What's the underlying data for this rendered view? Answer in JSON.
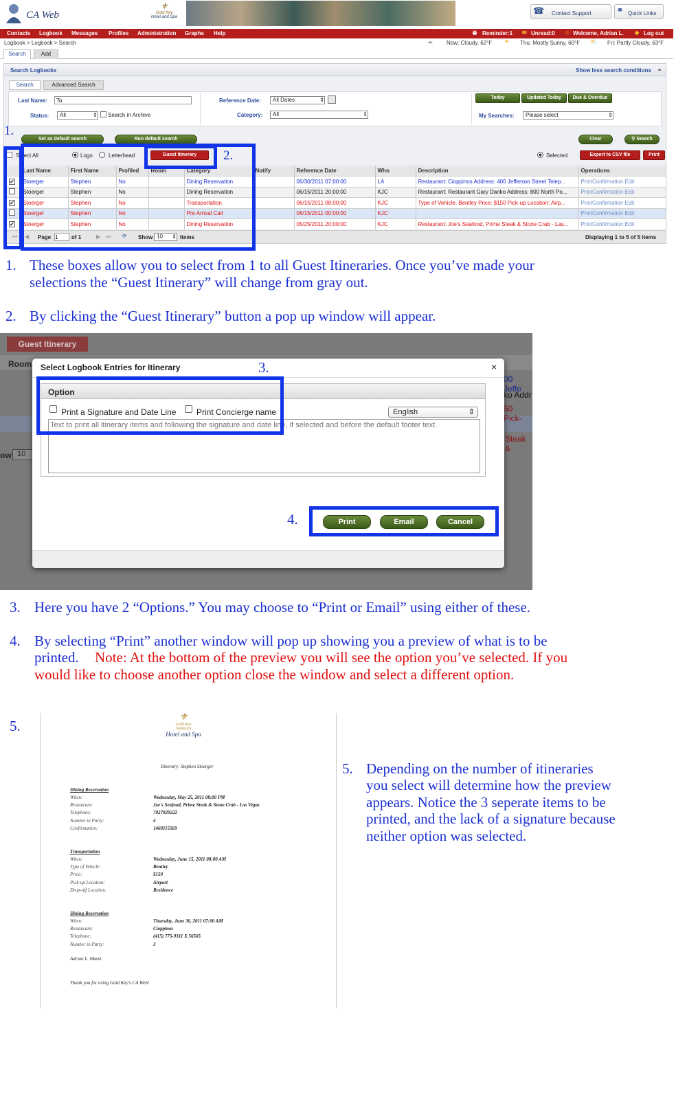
{
  "app": {
    "name": "CA Web",
    "hotel_line1": "Gold Key",
    "hotel_line2": "Solutions",
    "hotel_line3": "Hotel and Spa",
    "contact_support": "Contact Support",
    "quick_links": "Quick Links"
  },
  "nav": [
    "Contacts",
    "Logbook",
    "Messages",
    "Profiles",
    "Administration",
    "Graphs",
    "Help"
  ],
  "status": {
    "reminder": "Reminder:1",
    "unread": "Unread:0",
    "welcome": "Welcome, Adrian L.",
    "logout": "Log out"
  },
  "breadcrumb": "Logbook > Logbook > Search",
  "weather": {
    "now": "Now: Cloudy, 62°F",
    "thu": "Thu: Mostly Sunny, 60°F",
    "fri": "Fri: Partly Cloudy, 63°F"
  },
  "tabs": [
    "Search",
    "Add"
  ],
  "panel": {
    "title": "Search Logbooks",
    "toggle": "Show less search conditions",
    "subtabs": [
      "Search",
      "Advanced Search"
    ]
  },
  "form": {
    "last_name_label": "Last Name:",
    "last_name_value": "To",
    "status_label": "Status:",
    "status_value": "All",
    "archive_label": "Search in Archive",
    "ref_date_label": "Reference Date:",
    "ref_date_value": "All Dates",
    "category_label": "Category:",
    "category_value": "All",
    "today": "Today",
    "updated_today": "Updated Today",
    "due_overdue": "Due & Overdue",
    "my_searches_label": "My Searches:",
    "my_searches_value": "Please select"
  },
  "actions": {
    "set_default": "Set as default search",
    "run_default": "Run default search",
    "clear": "Clear",
    "search": "Search",
    "select_all": "Select All",
    "logo": "Logo",
    "letterhead": "Letterhead",
    "guest_itinerary": "Guest Itinerary",
    "selected": "Selected",
    "export": "Export to CSV file",
    "print": "Print"
  },
  "table": {
    "headers": [
      "Last Name",
      "First Name",
      "Profiled",
      "Room",
      "Category",
      "Notify",
      "Reference Date",
      "Who",
      "Description",
      "Operations"
    ],
    "rows": [
      {
        "last": "Stoerger",
        "first": "Stephen",
        "profiled": "No",
        "category": "Dining Reservation",
        "date": "06/30/2011 07:00:00",
        "who": "LA",
        "desc": "Restaurant: Cioppinos Address: 400 Jefferson Street Telep...",
        "ops": "PrintConfirmation  Edit",
        "checked": true,
        "color": "#1a2fd1",
        "bg": "#ffffff"
      },
      {
        "last": "Stoerger",
        "first": "Stephen",
        "profiled": "No",
        "category": "Dining Reservation",
        "date": "06/15/2011 20:00:00",
        "who": "KJC",
        "desc": "Restaurant: Restaurant Gary Danko Address: 800 North Po...",
        "ops": "PrintConfirmation  Edit",
        "checked": false,
        "color": "#111111",
        "bg": "#f2f2f2"
      },
      {
        "last": "Stoerger",
        "first": "Stephen",
        "profiled": "No",
        "category": "Transportation",
        "date": "06/15/2011 08:00:00",
        "who": "KJC",
        "desc": "Type of Vehicle: Bentley Price: $150 Pick-up Location: Airp...",
        "ops": "PrintConfirmation  Edit",
        "checked": true,
        "color": "#e01010",
        "bg": "#ffffff"
      },
      {
        "last": "Stoerger",
        "first": "Stephen",
        "profiled": "No",
        "category": "Pre Arrival Call",
        "date": "06/15/2011 00:00:00",
        "who": "KJC",
        "desc": "",
        "ops": "PrintConfirmation  Edit",
        "checked": false,
        "color": "#e01010",
        "bg": "#dbe6f7"
      },
      {
        "last": "Stoerger",
        "first": "Stephen",
        "profiled": "No",
        "category": "Dining Reservation",
        "date": "05/25/2011 20:00:00",
        "who": "KJC",
        "desc": "Restaurant: Joe's Seafood, Prime Steak & Stone Crab - Las...",
        "ops": "PrintConfirmation  Edit",
        "checked": true,
        "color": "#e01010",
        "bg": "#ffffff"
      }
    ]
  },
  "pager": {
    "page_label": "Page",
    "page_value": "1",
    "of": "of 1",
    "show_label": "Show",
    "show_value": "10",
    "items": "Items",
    "displaying": "Displaying 1 to 5 of 5 items"
  },
  "markers": {
    "m1": "1.",
    "m2": "2.",
    "m3": "3.",
    "m4": "4.",
    "m5": "5."
  },
  "steps": {
    "s1_num": "1.",
    "s1_a": "These boxes allow you to select from 1 to all Guest Itineraries.  Once you’ve made your",
    "s1_b": "selections the “Guest Itinerary” will change from gray out.",
    "s2_num": "2.",
    "s2": "By clicking the “Guest Itinerary” button a pop up window will appear.",
    "s3_num": "3.",
    "s3": "Here you have 2 “Options.” You may choose to “Print or Email” using either of these.",
    "s4_num": "4.",
    "s4_a": "By selecting “Print” another window will pop up showing you a preview of what is to be",
    "s4_b": "printed.",
    "s4_c": "Note: At the bottom of the preview you will see the option you’ve selected.  If you",
    "s4_d": "would like to choose another option close the window and select a different option.",
    "s5_num": "5.",
    "s5": [
      "Depending on the number of itineraries",
      "you select will determine how the preview",
      "appears.  Notice the 3 seperate items to be",
      "printed, and the lack of a signature because",
      "neither option was selected."
    ]
  },
  "dialog": {
    "bg_button": "Guest Itinerary",
    "bg_room": "Room",
    "bg_show": "ow",
    "bg_show_value": "10",
    "bg_right": [
      "00 Jeffe",
      "ko Addr",
      "50 Pick-",
      "Steak &"
    ],
    "title": "Select Logbook Entries for Itinerary",
    "close": "×",
    "option_header": "Option",
    "signature_label": "Print a Signature and Date Line",
    "concierge_label": "Print Concierge name",
    "language": "English",
    "textarea_placeholder": "Text to print all itinerary items and following the signature and date line, if selected and before the default footer text.",
    "print": "Print",
    "email": "Email",
    "cancel": "Cancel"
  },
  "preview": {
    "logo1": "Gold Key",
    "logo2": "Solutions",
    "logo3": "Hotel and Spa",
    "title": "Itinerary: Stephen Stoerger",
    "sections": [
      {
        "heading": "Dining Reservation",
        "rows": [
          [
            "When:",
            "Wednesday, May 25, 2011 08:00 PM"
          ],
          [
            "Restaurant:",
            "Joe's Seafood, Prime Steak & Stone Crab - Las Vegas"
          ],
          [
            "Telephone:",
            "7027929222"
          ],
          [
            "Number in Party:",
            "4"
          ],
          [
            "Confirmation:",
            "1460115569"
          ]
        ]
      },
      {
        "heading": "Transportation",
        "rows": [
          [
            "When:",
            "Wednesday, June 15, 2011 08:00 AM"
          ],
          [
            "Type of Vehicle:",
            "Bentley"
          ],
          [
            "Price:",
            "$150"
          ],
          [
            "Pick-up Location:",
            "Airport"
          ],
          [
            "Drop-off Location:",
            "Residence"
          ]
        ]
      },
      {
        "heading": "Dining Reservation",
        "rows": [
          [
            "When:",
            "Thursday, June 30, 2011 07:00 AM"
          ],
          [
            "Restaurant:",
            "Cioppinos"
          ],
          [
            "Telephone:",
            "(415) 775-9311 X 56565"
          ],
          [
            "Number in Party:",
            "3"
          ]
        ]
      }
    ],
    "signer": "Adrian L. Massi",
    "footer": "Thank you for using Gold Key's CA Web!"
  }
}
